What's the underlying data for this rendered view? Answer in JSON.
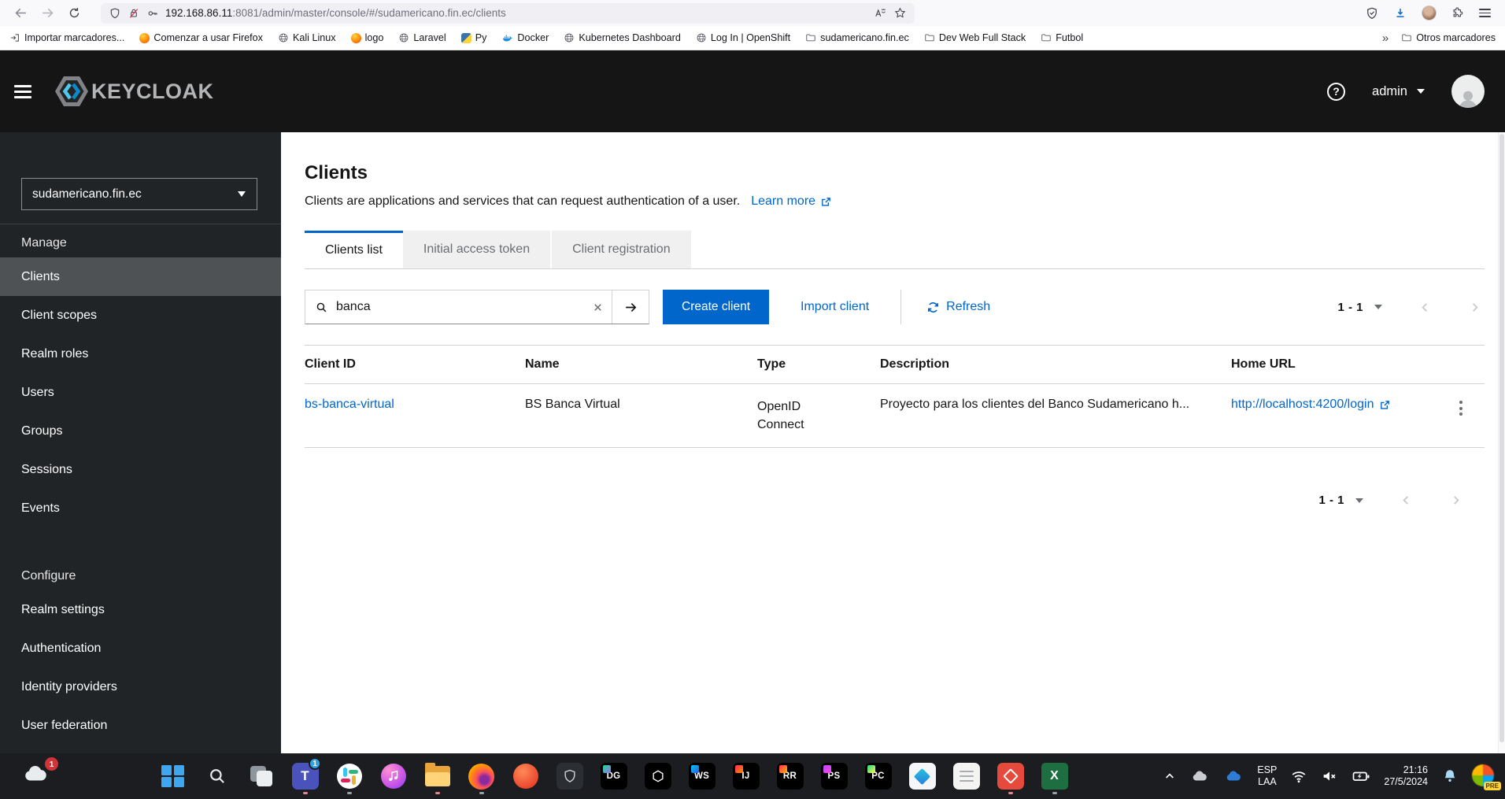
{
  "browser": {
    "url": {
      "host": "192.168.86.11",
      "path": ":8081/admin/master/console/#/sudamericano.fin.ec/clients"
    },
    "bookmarks": [
      "Importar marcadores...",
      "Comenzar a usar Firefox",
      "Kali Linux",
      "logo",
      "Laravel",
      "Py",
      "Docker",
      "Kubernetes Dashboard",
      "Log In | OpenShift",
      "sudamericano.fin.ec",
      "Dev Web Full Stack",
      "Futbol"
    ],
    "bookmarks_overflow": "»",
    "other_bookmarks": "Otros marcadores"
  },
  "masthead": {
    "brand": "KEYCLOAK",
    "username": "admin",
    "help_glyph": "?"
  },
  "sidebar": {
    "realm": "sudamericano.fin.ec",
    "manage_label": "Manage",
    "manage_items": [
      "Clients",
      "Client scopes",
      "Realm roles",
      "Users",
      "Groups",
      "Sessions",
      "Events"
    ],
    "configure_label": "Configure",
    "configure_items": [
      "Realm settings",
      "Authentication",
      "Identity providers",
      "User federation"
    ]
  },
  "page": {
    "title": "Clients",
    "description": "Clients are applications and services that can request authentication of a user.",
    "learn_more": "Learn more",
    "tabs": [
      "Clients list",
      "Initial access token",
      "Client registration"
    ],
    "toolbar": {
      "search_value": "banca",
      "create": "Create client",
      "import": "Import client",
      "refresh": "Refresh",
      "pagination": "1 - 1"
    },
    "table": {
      "columns": [
        "Client ID",
        "Name",
        "Type",
        "Description",
        "Home URL"
      ],
      "row": {
        "client_id": "bs-banca-virtual",
        "name": "BS Banca Virtual",
        "type": "OpenID Connect",
        "description": "Proyecto para los clientes del Banco Sudamericano h...",
        "home_url": "http://localhost:4200/login"
      }
    },
    "pagination_bottom": "1 - 1"
  },
  "taskbar": {
    "widgets_badge": "1",
    "teams_badge": "1",
    "app_labels": {
      "teams": "T",
      "datagrip": "DG",
      "webstorm": "WS",
      "intellij": "IJ",
      "rustrover": "RR",
      "phpstorm": "PS",
      "pycharm": "PC",
      "excel": "X"
    },
    "tray": {
      "lang_line1": "ESP",
      "lang_line2": "LAA",
      "time": "21:16",
      "date": "27/5/2024",
      "copilot_badge": "PRE"
    }
  },
  "colors": {
    "accent": "#0066cc",
    "masthead_bg": "#151515",
    "sidebar_bg": "#212427",
    "sidebar_selected": "#4f5255",
    "border": "#d2d2d2",
    "link": "#0066cc",
    "tab_inactive_bg": "#f0f0f0",
    "taskbar_bg": "#1c1d21"
  }
}
